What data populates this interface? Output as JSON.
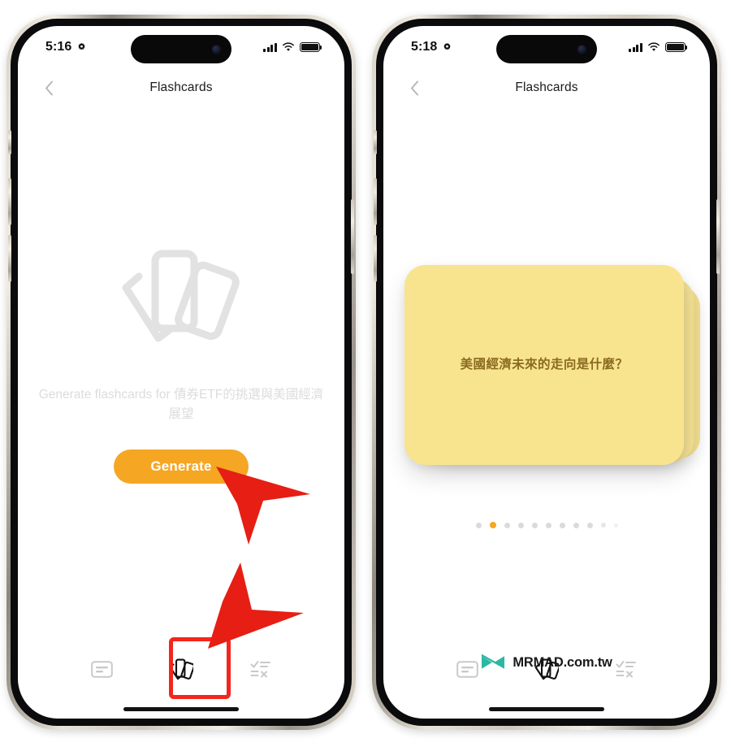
{
  "meta": {
    "accent_orange": "#F5A623",
    "card_yellow": "#F8E48E",
    "card_text_brown": "#8a6a21",
    "highlight_red": "#F4251C",
    "logo_teal": "#2BB8A3"
  },
  "phone_left": {
    "status": {
      "time": "5:16",
      "gear_icon": "gear-icon",
      "signal_icon": "cellular-signal-icon",
      "wifi_icon": "wifi-icon",
      "battery_icon": "battery-full-icon"
    },
    "nav": {
      "back_icon": "chevron-left-icon",
      "title": "Flashcards"
    },
    "empty_state": {
      "illustration_icon": "flashcards-illustration-icon",
      "prompt": "Generate flashcards for 債券ETF的挑選與美國經濟展望",
      "generate_label": "Generate"
    },
    "tabs": [
      {
        "name": "tab-summary",
        "icon": "summary-card-icon",
        "active": false
      },
      {
        "name": "tab-flashcards",
        "icon": "flashcards-icon",
        "active": true
      },
      {
        "name": "tab-quiz",
        "icon": "quiz-checklist-icon",
        "active": false
      }
    ]
  },
  "phone_right": {
    "status": {
      "time": "5:18",
      "gear_icon": "gear-icon",
      "signal_icon": "cellular-signal-icon",
      "wifi_icon": "wifi-icon",
      "battery_icon": "battery-full-icon"
    },
    "nav": {
      "back_icon": "chevron-left-icon",
      "title": "Flashcards"
    },
    "flashcard": {
      "question": "美國經濟未來的走向是什麼？",
      "page_dots_total": 11,
      "page_dots_active_index": 2
    },
    "watermark": {
      "logo_icon": "mrmad-bowtie-logo-icon",
      "brand": "MRMAD",
      "suffix": ".com.tw"
    },
    "tabs": [
      {
        "name": "tab-summary",
        "icon": "summary-card-icon",
        "active": false
      },
      {
        "name": "tab-flashcards",
        "icon": "flashcards-icon",
        "active": true
      },
      {
        "name": "tab-quiz",
        "icon": "quiz-checklist-icon",
        "active": false
      }
    ]
  },
  "annotations": {
    "arrow_1": "red-arrow-pointing-to-generate-button",
    "arrow_2": "red-arrow-pointing-to-flashcards-tab",
    "highlight_box": "red-highlight-box-flashcards-tab"
  }
}
